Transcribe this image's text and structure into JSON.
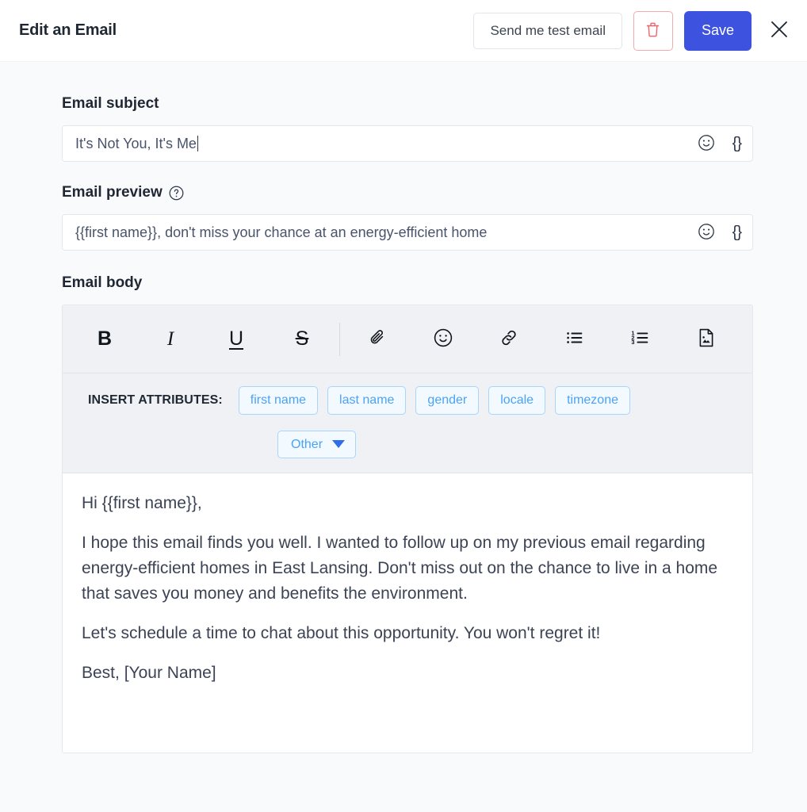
{
  "header": {
    "title": "Edit an Email",
    "test_email_label": "Send me test email",
    "save_label": "Save",
    "delete_icon": "trash-icon",
    "close_icon": "close-icon"
  },
  "subject": {
    "label": "Email subject",
    "value": "It's Not You, It's Me",
    "emoji_icon": "smiley-icon",
    "brace_icon": "{}"
  },
  "preview": {
    "label": "Email preview",
    "help_icon": "question-mark-icon",
    "value": "{{first name}}, don't miss your chance at an energy-efficient home",
    "emoji_icon": "smiley-icon",
    "brace_icon": "{}"
  },
  "body_section": {
    "label": "Email body"
  },
  "toolbar": {
    "bold": "B",
    "italic": "I",
    "underline": "U",
    "strikethrough": "S",
    "attach_icon": "paperclip-icon",
    "emoji_icon": "smiley-icon",
    "link_icon": "link-icon",
    "bullet_list_icon": "bulleted-list-icon",
    "numbered_list_icon": "numbered-list-icon",
    "image_icon": "image-file-icon"
  },
  "attributes": {
    "title": "INSERT ATTRIBUTES:",
    "chips": [
      {
        "label": "first name"
      },
      {
        "label": "last name"
      },
      {
        "label": "gender"
      },
      {
        "label": "locale"
      },
      {
        "label": "timezone"
      }
    ],
    "other_label": "Other",
    "other_caret_icon": "caret-down-icon"
  },
  "email_body": {
    "paragraphs": [
      "Hi {{first name}},",
      "I hope this email finds you well. I wanted to follow up on my previous email regarding energy-efficient homes in East Lansing. Don't miss out on the chance to live in a home that saves you money and benefits the environment.",
      "Let's schedule a time to chat about this opportunity. You won't regret it!",
      "Best, [Your Name]"
    ]
  },
  "colors": {
    "accent": "#3d53df",
    "danger": "#f5aaae",
    "chip_text": "#4ba3f5",
    "chip_border": "#a8d5fb",
    "page_bg": "#f9fafc",
    "toolbar_bg": "#eff1f5"
  }
}
